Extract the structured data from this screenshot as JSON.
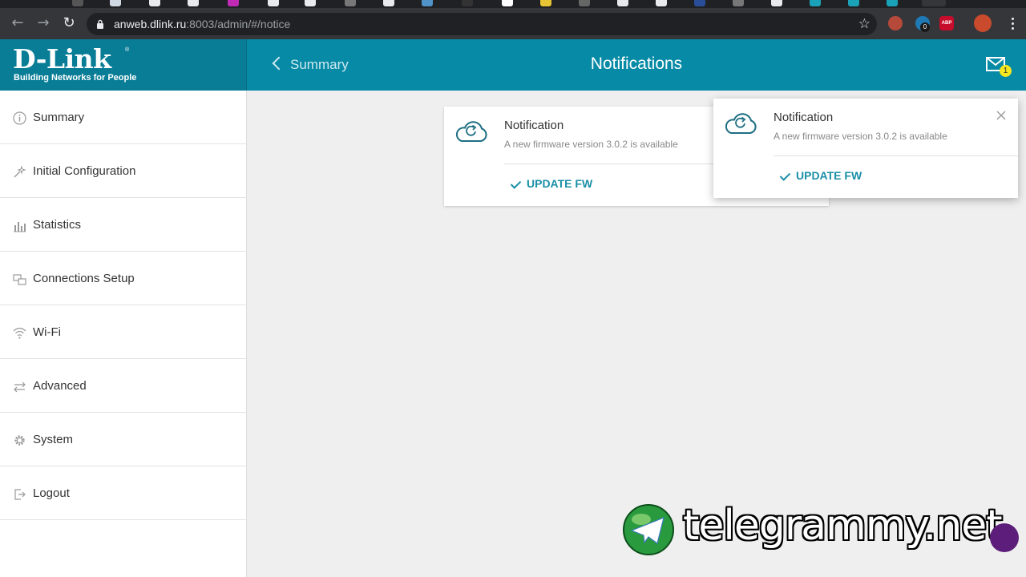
{
  "browser": {
    "url_host": "anweb.dlink.ru",
    "url_path": ":8003/admin/#/notice",
    "extensions": {
      "badge_count": "0",
      "abp_label": "ABP"
    }
  },
  "header": {
    "logo_text": "D-Link",
    "logo_tagline": "Building Networks for People",
    "back_label": "Summary",
    "title": "Notifications",
    "mail_count": "1",
    "accent_color": "#068aa6"
  },
  "sidebar": {
    "items": [
      {
        "label": "Summary",
        "icon": "info-icon"
      },
      {
        "label": "Initial Configuration",
        "icon": "wand-icon"
      },
      {
        "label": "Statistics",
        "icon": "bar-chart-icon"
      },
      {
        "label": "Connections Setup",
        "icon": "connections-icon"
      },
      {
        "label": "Wi-Fi",
        "icon": "wifi-icon"
      },
      {
        "label": "Advanced",
        "icon": "arrows-icon"
      },
      {
        "label": "System",
        "icon": "gear-icon"
      },
      {
        "label": "Logout",
        "icon": "logout-icon"
      }
    ]
  },
  "notifications": [
    {
      "title": "Notification",
      "text": "A new firmware version 3.0.2 is available",
      "action": "UPDATE FW"
    },
    {
      "title": "Notification",
      "text": "A new firmware version 3.0.2 is available",
      "action": "UPDATE FW"
    }
  ],
  "watermark": {
    "text": "telegrammy.net"
  }
}
